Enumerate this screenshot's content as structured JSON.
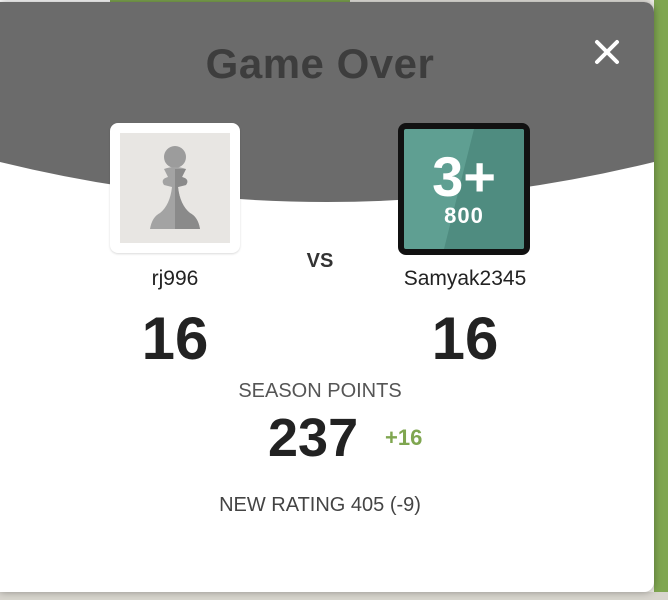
{
  "modal": {
    "title": "Game Over",
    "close_label": "×"
  },
  "players": {
    "left": {
      "name": "rj996",
      "score": "16",
      "avatar": "pawn-icon"
    },
    "right": {
      "name": "Samyak2345",
      "score": "16",
      "badge_top": "3+",
      "badge_bottom": "800"
    },
    "vs_label": "VS"
  },
  "season": {
    "label": "SEASON POINTS",
    "points": "237",
    "delta": "+16"
  },
  "rating": {
    "text": "NEW RATING 405 (-9)"
  },
  "colors": {
    "header_gray": "#6b6b6b",
    "accent_green": "#7fa650",
    "badge_teal": "#5f9f92"
  }
}
